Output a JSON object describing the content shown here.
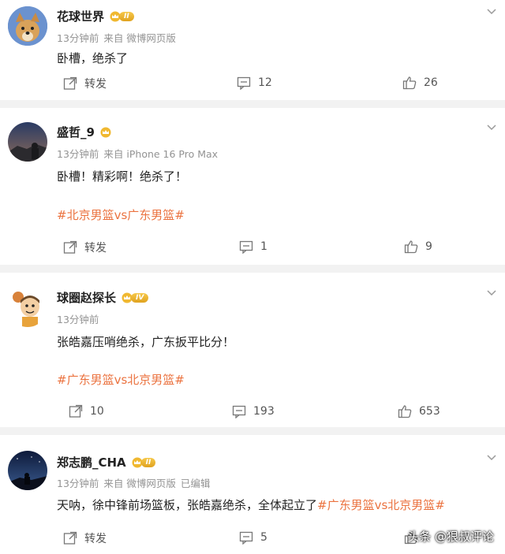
{
  "posts": [
    {
      "username": "花球世界",
      "level": "II",
      "time": "13分钟前",
      "source": "来自 微博网页版",
      "edited": "",
      "text": "卧槽，绝杀了",
      "hashtag": "",
      "repost_label": "转发",
      "comments": "12",
      "likes": "26"
    },
    {
      "username": "盛哲_9",
      "level": "",
      "time": "13分钟前",
      "source": "来自 iPhone 16 Pro Max",
      "edited": "",
      "text": "卧槽！精彩啊！绝杀了！",
      "hashtag": "#北京男篮vs广东男篮#",
      "repost_label": "转发",
      "comments": "1",
      "likes": "9"
    },
    {
      "username": "球圈赵探长",
      "level": "IV",
      "time": "13分钟前",
      "source": "",
      "edited": "",
      "text": "张皓嘉压哨绝杀，广东扳平比分！",
      "hashtag": "#广东男篮vs北京男篮#",
      "repost_label": "10",
      "comments": "193",
      "likes": "653"
    },
    {
      "username": "郑志鹏_CHA",
      "level": "II",
      "time": "13分钟前",
      "source": "来自 微博网页版",
      "edited": "已编辑",
      "text": "天呐，徐中锋前场篮板，张皓嘉绝杀，全体起立了",
      "hashtag": "#广东男篮vs北京男篮#",
      "repost_label": "转发",
      "comments": "5",
      "likes": ""
    }
  ],
  "watermark": "头条 @狠叔评论",
  "colors": {
    "hashtag": "#eb7340",
    "meta": "#939393",
    "badge": "#f0b830"
  }
}
